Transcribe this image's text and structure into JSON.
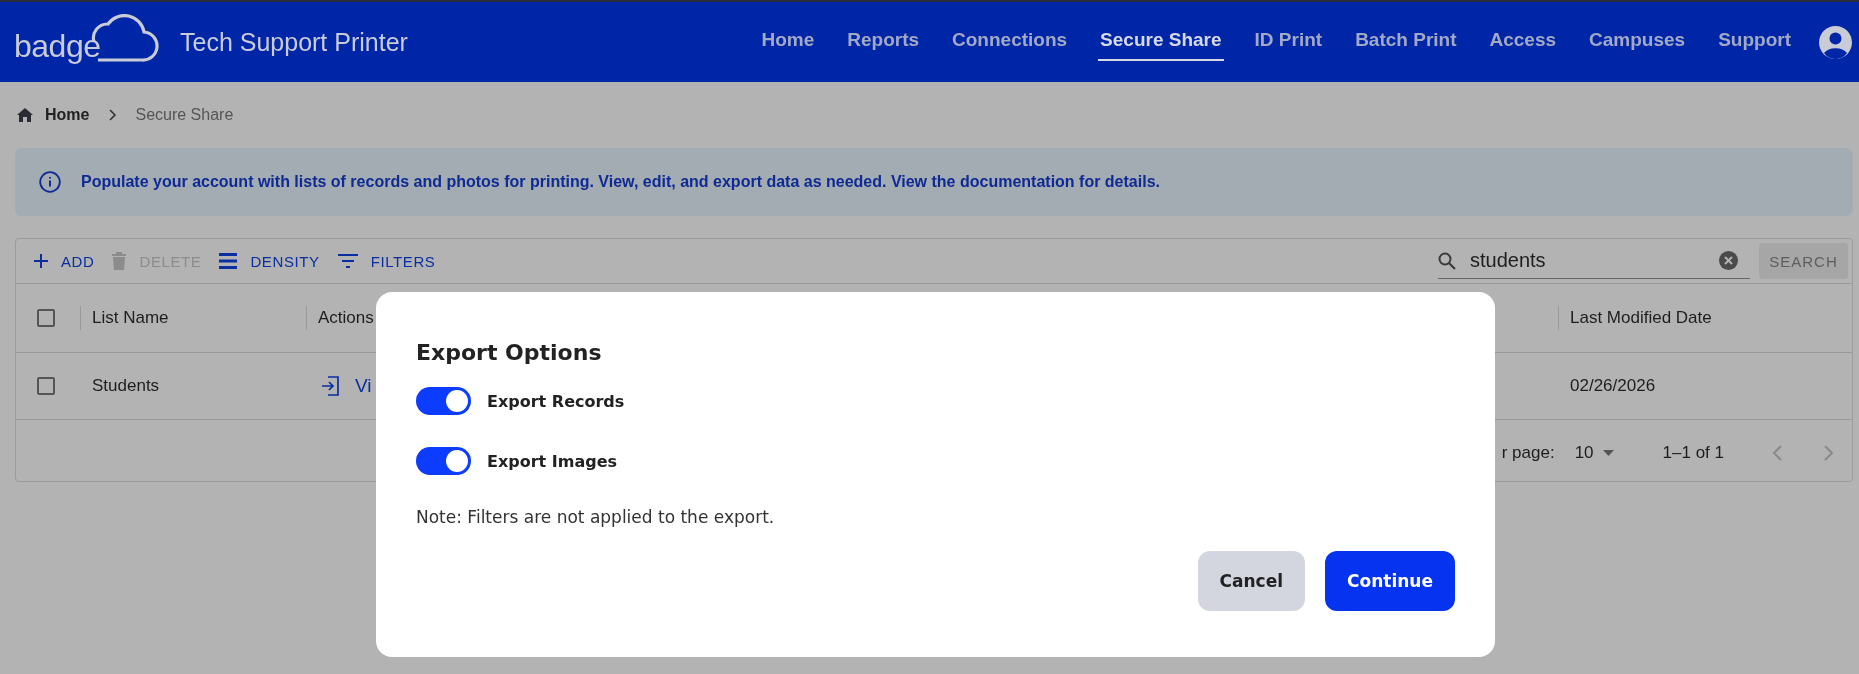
{
  "header": {
    "logo": "badge",
    "app_title": "Tech Support Printer",
    "nav": [
      {
        "label": "Home",
        "selected": false
      },
      {
        "label": "Reports",
        "selected": false
      },
      {
        "label": "Connections",
        "selected": false
      },
      {
        "label": "Secure Share",
        "selected": true
      },
      {
        "label": "ID Print",
        "selected": false
      },
      {
        "label": "Batch Print",
        "selected": false
      },
      {
        "label": "Access",
        "selected": false
      },
      {
        "label": "Campuses",
        "selected": false
      },
      {
        "label": "Support",
        "selected": false
      }
    ]
  },
  "breadcrumb": [
    "Home",
    "Secure Share"
  ],
  "info_banner": {
    "text": "Populate your account with lists of records and photos for printing. View, edit, and export data as needed. View the documentation for details."
  },
  "toolbar": {
    "buttons": [
      {
        "label": "ADD",
        "kind": "add",
        "disabled": false
      },
      {
        "label": "DELETE",
        "kind": "delete",
        "disabled": true
      },
      {
        "label": "DENSITY",
        "kind": "density",
        "disabled": false
      },
      {
        "label": "FILTERS",
        "kind": "filters",
        "disabled": false
      }
    ],
    "search": {
      "value": "students",
      "button": "SEARCH",
      "disabled": true
    }
  },
  "table": {
    "select_all_checked": false,
    "columns": [
      "List Name",
      "Actions",
      "Last Modified Date"
    ],
    "rows": [
      {
        "checked": false,
        "list_name": "Students",
        "action": "Vi",
        "last_modified": "02/26/2026"
      }
    ]
  },
  "pagination": {
    "rows_per_page_label": "r page:",
    "rows_per_page": "10",
    "range": "1–1 of 1"
  },
  "dialog": {
    "title": "Export Options",
    "toggles": [
      {
        "label": "Export Records",
        "on": true
      },
      {
        "label": "Export Images",
        "on": true
      }
    ],
    "note": "Note: Filters are not applied to the export.",
    "buttons": [
      {
        "label": "Cancel",
        "kind": "secondary"
      },
      {
        "label": "Continue",
        "kind": "primary"
      }
    ]
  }
}
